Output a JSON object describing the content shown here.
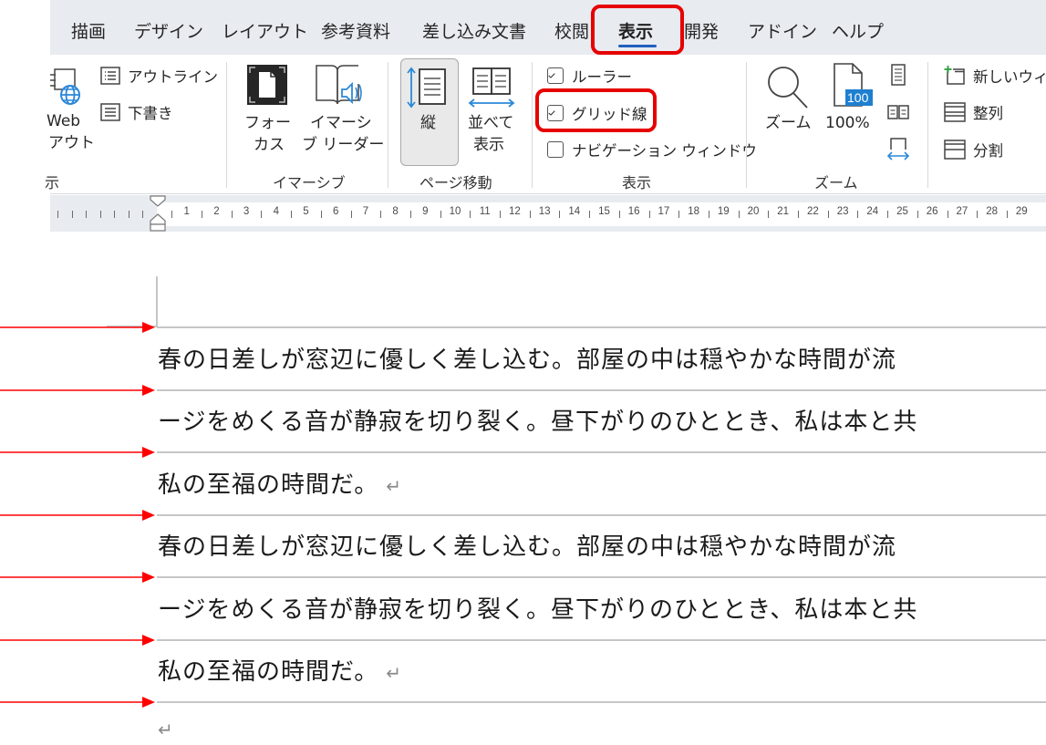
{
  "tabs": [
    {
      "label": "描画"
    },
    {
      "label": "デザイン"
    },
    {
      "label": "レイアウト"
    },
    {
      "label": "参考資料"
    },
    {
      "label": "差し込み文書"
    },
    {
      "label": "校閲"
    },
    {
      "label": "表示",
      "active": true
    },
    {
      "label": "開発"
    },
    {
      "label": "アドイン"
    },
    {
      "label": "ヘルプ"
    }
  ],
  "ribbon": {
    "views": {
      "web_layout_line1": "Web",
      "web_layout_line2": "アウト",
      "outline": "アウトライン",
      "draft": "下書き",
      "group_label": "示"
    },
    "immersive": {
      "focus_line1": "フォー",
      "focus_line2": "カス",
      "reader_line1": "イマーシ",
      "reader_line2": "ブ リーダー",
      "group_label": "イマーシブ"
    },
    "page_movement": {
      "vertical": "縦",
      "side_by_side_line1": "並べて",
      "side_by_side_line2": "表示",
      "group_label": "ページ移動"
    },
    "show": {
      "ruler": {
        "label": "ルーラー",
        "checked": true
      },
      "gridlines": {
        "label": "グリッド線",
        "checked": true
      },
      "navigation": {
        "label": "ナビゲーション ウィンドウ",
        "checked": false
      },
      "group_label": "表示"
    },
    "zoom": {
      "zoom_label": "ズーム",
      "hundred_label": "100%",
      "hundred_badge": "100",
      "group_label": "ズーム"
    },
    "window": {
      "new_window": "新しいウィン",
      "arrange": "整列",
      "split": "分割"
    }
  },
  "ruler": {
    "numbers": [
      "1",
      "2",
      "3",
      "4",
      "5",
      "6",
      "7",
      "8",
      "9",
      "10",
      "11",
      "12",
      "13",
      "14",
      "15",
      "16",
      "17",
      "18",
      "19",
      "20",
      "21",
      "22",
      "23",
      "24",
      "25",
      "26",
      "27",
      "28",
      "29"
    ]
  },
  "document": {
    "lines": [
      {
        "text": "春の日差しが窓辺に優しく差し込む。部屋の中は穏やかな時間が流",
        "para_mark": false
      },
      {
        "text": "ージをめくる音が静寂を切り裂く。昼下がりのひととき、私は本と共",
        "para_mark": false
      },
      {
        "text": "私の至福の時間だ。",
        "para_mark": true
      },
      {
        "text": "春の日差しが窓辺に優しく差し込む。部屋の中は穏やかな時間が流",
        "para_mark": false
      },
      {
        "text": "ージをめくる音が静寂を切り裂く。昼下がりのひととき、私は本と共",
        "para_mark": false
      },
      {
        "text": "私の至福の時間だ。",
        "para_mark": true
      }
    ],
    "para_mark_glyph": "↵",
    "gridline_count": 7
  },
  "colors": {
    "accent": "#1f5fbf",
    "highlight": "#e60000",
    "annotation_arrow": "#ff0000",
    "gridline": "#c6c6c6",
    "icon_blue": "#2b88d8"
  }
}
